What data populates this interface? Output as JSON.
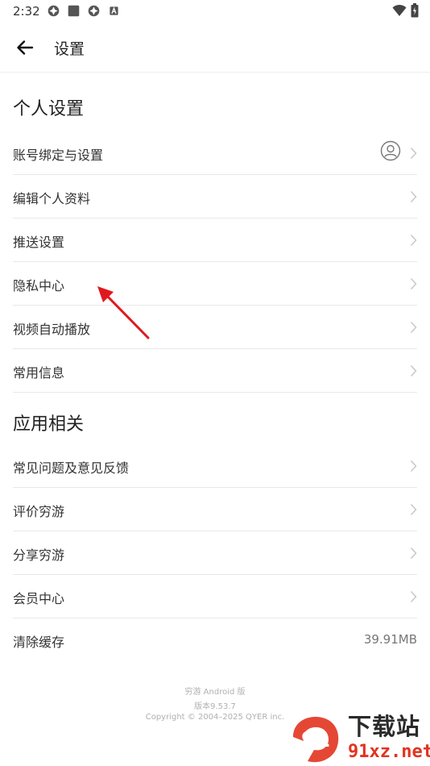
{
  "status_bar": {
    "time": "2:32",
    "left_icons": [
      "status-app-icon",
      "status-square-icon",
      "status-app-icon",
      "status-a-icon"
    ],
    "right_icons": [
      "wifi-icon",
      "battery-icon"
    ]
  },
  "header": {
    "back_icon": "back-arrow-icon",
    "title": "设置"
  },
  "personal": {
    "title": "个人设置",
    "items": [
      {
        "label": "账号绑定与设置"
      },
      {
        "label": "编辑个人资料"
      },
      {
        "label": "推送设置"
      },
      {
        "label": "隐私中心"
      },
      {
        "label": "视频自动播放"
      },
      {
        "label": "常用信息"
      }
    ]
  },
  "app": {
    "title": "应用相关",
    "items": [
      {
        "label": "常见问题及意见反馈"
      },
      {
        "label": "评价穷游"
      },
      {
        "label": "分享穷游"
      },
      {
        "label": "会员中心"
      },
      {
        "label": "清除缓存",
        "value": "39.91MB"
      }
    ]
  },
  "footer": {
    "app_name": "穷游 Android 版",
    "version": "版本9.53.7",
    "copyright": "Copyright © 2004–2025 QYER inc."
  },
  "watermark": {
    "logo_text": "91",
    "cn_text": "下载站",
    "url_text": "91xz.net"
  },
  "colors": {
    "annotation_arrow": "#e0191f",
    "watermark_red": "#e2331f"
  }
}
